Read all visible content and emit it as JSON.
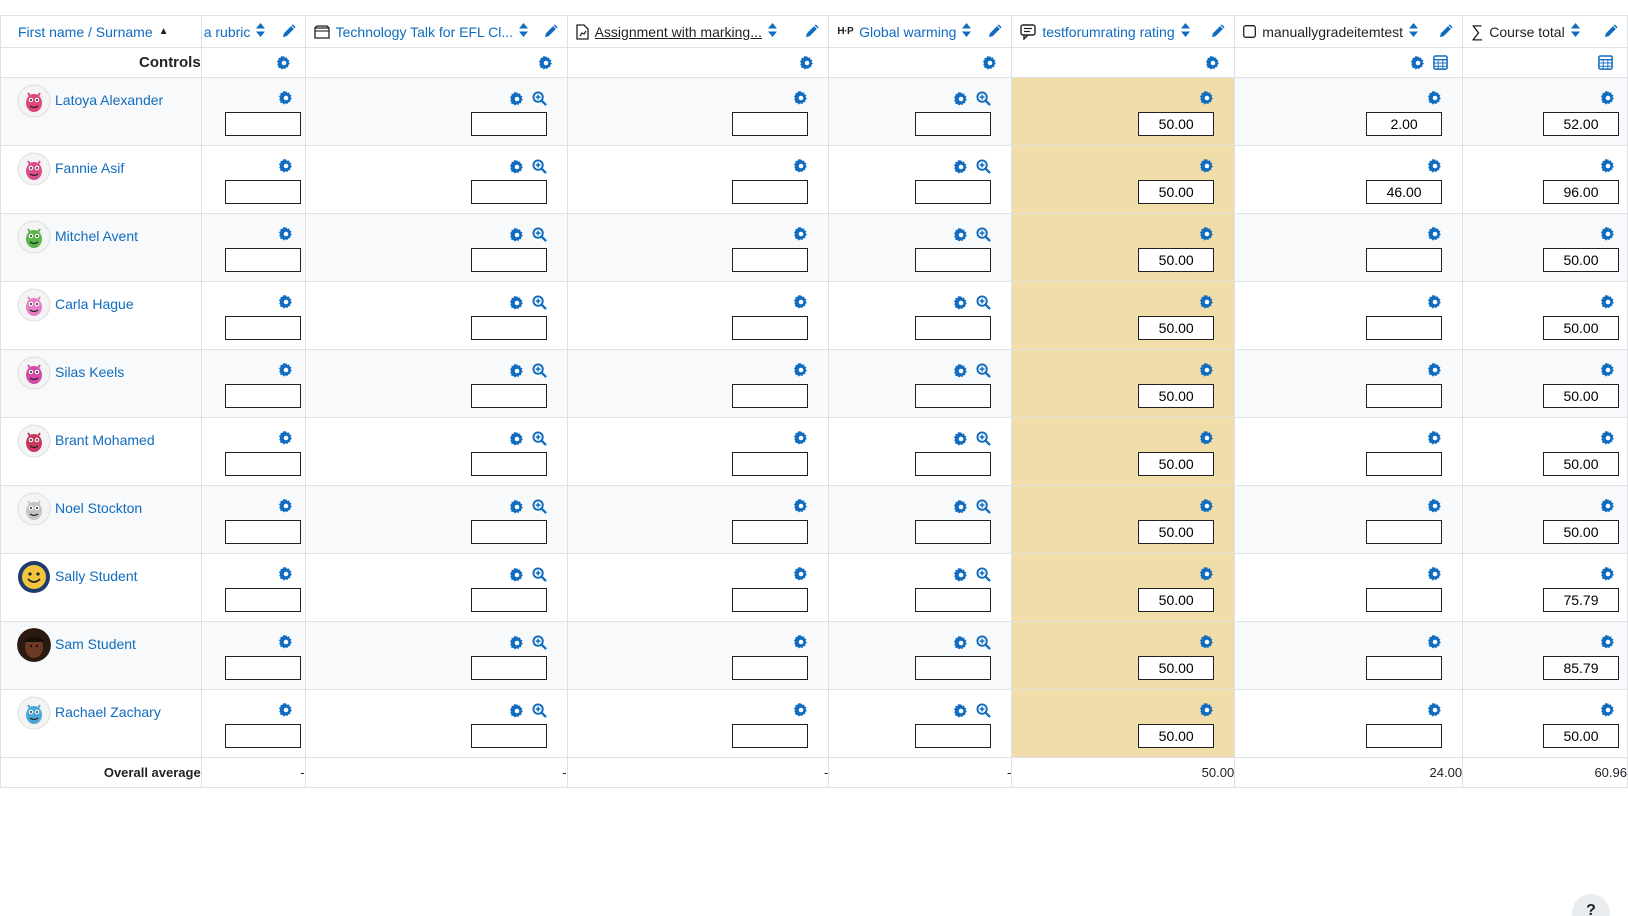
{
  "header": {
    "name_column": "First name / Surname",
    "columns": [
      {
        "label": "a rubric",
        "style": "link",
        "icon": ""
      },
      {
        "label": "Technology Talk for EFL Cl...",
        "style": "link",
        "icon": "book-icon"
      },
      {
        "label": "Assignment with marking...",
        "style": "underline",
        "icon": "assignment-icon"
      },
      {
        "label": "Global warming",
        "style": "link",
        "icon": "h5p-icon"
      },
      {
        "label": "testforumrating rating",
        "style": "link",
        "icon": "forum-icon"
      },
      {
        "label": "manuallygradeitemtest",
        "style": "plain",
        "icon": "checkbox-icon"
      },
      {
        "label": "Course total",
        "style": "plain",
        "icon": "sigma-icon"
      }
    ]
  },
  "controls_label": "Controls",
  "students": [
    {
      "name": "Latoya Alexander",
      "avatar": "monster-icon",
      "color": "#e0457b",
      "grades": [
        "",
        "",
        "",
        "",
        "50.00",
        "2.00",
        "52.00"
      ]
    },
    {
      "name": "Fannie Asif",
      "avatar": "monster-icon",
      "color": "#d94f8c",
      "grades": [
        "",
        "",
        "",
        "",
        "50.00",
        "46.00",
        "96.00"
      ]
    },
    {
      "name": "Mitchel Avent",
      "avatar": "monster-icon",
      "color": "#5bb548",
      "grades": [
        "",
        "",
        "",
        "",
        "50.00",
        "",
        "50.00"
      ]
    },
    {
      "name": "Carla Hague",
      "avatar": "monster-icon",
      "color": "#e680c6",
      "grades": [
        "",
        "",
        "",
        "",
        "50.00",
        "",
        "50.00"
      ]
    },
    {
      "name": "Silas Keels",
      "avatar": "monster-icon",
      "color": "#d44aa8",
      "grades": [
        "",
        "",
        "",
        "",
        "50.00",
        "",
        "50.00"
      ]
    },
    {
      "name": "Brant Mohamed",
      "avatar": "monster-icon",
      "color": "#c9385e",
      "grades": [
        "",
        "",
        "",
        "",
        "50.00",
        "",
        "50.00"
      ]
    },
    {
      "name": "Noel Stockton",
      "avatar": "monster-icon",
      "color": "#c4c4c4",
      "grades": [
        "",
        "",
        "",
        "",
        "50.00",
        "",
        "50.00"
      ]
    },
    {
      "name": "Sally Student",
      "avatar": "smiley-icon",
      "color": "#f2c53d",
      "grades": [
        "",
        "",
        "",
        "",
        "50.00",
        "",
        "75.79"
      ]
    },
    {
      "name": "Sam Student",
      "avatar": "photo-icon",
      "color": "#6b3a22",
      "grades": [
        "",
        "",
        "",
        "",
        "50.00",
        "",
        "85.79"
      ]
    },
    {
      "name": "Rachael Zachary",
      "avatar": "monster-icon",
      "color": "#4aa8d8",
      "grades": [
        "",
        "",
        "",
        "",
        "50.00",
        "",
        "50.00"
      ]
    }
  ],
  "averages": {
    "label": "Overall average",
    "values": [
      "-",
      "-",
      "-",
      "-",
      "50.00",
      "24.00",
      "60.96"
    ]
  },
  "help_button": "?",
  "colors": {
    "accent": "#0f6cbf",
    "highlight_column": "#f1dda9"
  }
}
